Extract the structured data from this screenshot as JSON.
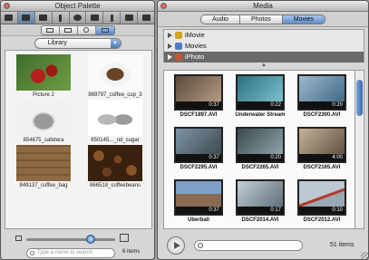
{
  "palette": {
    "title": "Object Palette",
    "tools": [
      "layout-tool-icon",
      "shapes-tool-icon",
      "layers-tool-icon",
      "text-tool-icon",
      "graphics-tool-icon",
      "photos-tool-icon",
      "info-tool-icon",
      "settings-tool-icon",
      "font-tool-icon"
    ],
    "library_label": "Library",
    "items": [
      {
        "caption": "Picture 2",
        "color1": "#3f6e2b",
        "color2": "#b3211e"
      },
      {
        "caption": "869797_coffee_cup_3",
        "color1": "#fafafa",
        "color2": "#6b4427"
      },
      {
        "caption": "854675_cafetera",
        "color1": "#f1f1f1",
        "color2": "#9a9a9a"
      },
      {
        "caption": "850145..._nd_sugar",
        "color1": "#ffffff",
        "color2": "#b8b8b8"
      },
      {
        "caption": "849137_coffee_bag",
        "color1": "#8e6a43",
        "color2": "#3c2b1c"
      },
      {
        "caption": "866518_coffeebeans",
        "color1": "#6a3f1f",
        "color2": "#2b170a"
      }
    ],
    "search_placeholder": "Type a name to search",
    "count": "6 items"
  },
  "media": {
    "title": "Media",
    "tabs": [
      "Audio",
      "Photos",
      "Movies"
    ],
    "selected_tab": "Movies",
    "sources": [
      {
        "label": "iMovie",
        "icon_color": "#d5a21b"
      },
      {
        "label": "Movies",
        "icon_color": "#4f7bc4"
      },
      {
        "label": "iPhoto",
        "icon_color": "#c1572f"
      }
    ],
    "clips": [
      {
        "name": "DSCF1897.AVI",
        "time": "0:37",
        "c1": "#5c4a3d",
        "c2": "#b59a81"
      },
      {
        "name": "Underwater Stream",
        "time": "0:22",
        "c1": "#2c6f80",
        "c2": "#7cc0cc"
      },
      {
        "name": "DSCF2300.AVI",
        "time": "0:20",
        "c1": "#9fb7c9",
        "c2": "#3f6a8a"
      },
      {
        "name": "DSCF2295.AVI",
        "time": "0:37",
        "c1": "#7f95a6",
        "c2": "#3c4a52"
      },
      {
        "name": "DSCF2265.AVI",
        "time": "0:20",
        "c1": "#3a4a4d",
        "c2": "#8ea3a9"
      },
      {
        "name": "DSCF2165.AVI",
        "time": "4:00",
        "c1": "#c6b49a",
        "c2": "#5f5040"
      },
      {
        "name": "Uberball",
        "time": "0:37",
        "c1": "#7da0c8",
        "c2": "#8a6a52"
      },
      {
        "name": "DSCF2014.AVI",
        "time": "0:17",
        "c1": "#c3ced6",
        "c2": "#5f6f7a"
      },
      {
        "name": "DSCF2012.AVI",
        "time": "0:10",
        "c1": "#bcc8d2",
        "c2": "#b43a2a"
      }
    ],
    "count": "51 items"
  }
}
